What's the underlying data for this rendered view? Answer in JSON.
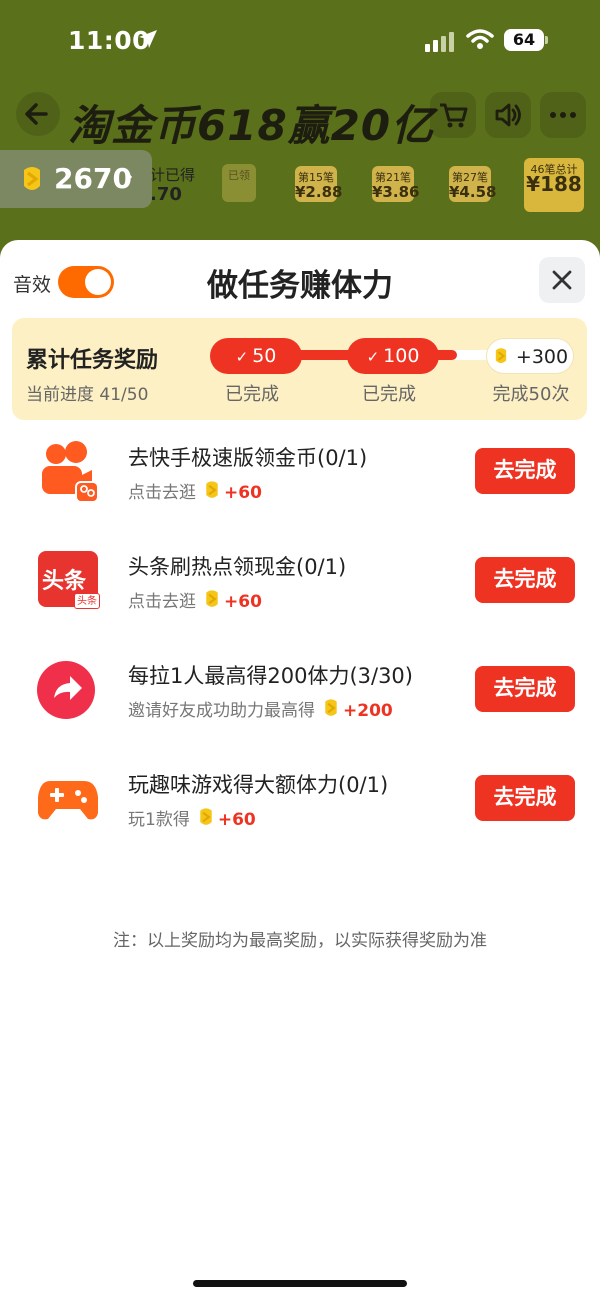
{
  "status_bar": {
    "time": "11:00",
    "battery": "64"
  },
  "background": {
    "title": "淘金币618赢20亿",
    "balance": "2670",
    "strip": {
      "accum_label": "计已得",
      "accum_value": ".70",
      "pills": [
        {
          "top": "已领",
          "value": ""
        },
        {
          "top": "第15笔",
          "value": "¥2.88"
        },
        {
          "top": "第21笔",
          "value": "¥3.86"
        },
        {
          "top": "第27笔",
          "value": "¥4.58"
        },
        {
          "top": "46笔总计",
          "value": "¥188"
        }
      ]
    }
  },
  "sheet": {
    "sound_label": "音效",
    "sound_on": true,
    "title": "做任务赚体力",
    "cumulative": {
      "title": "累计任务奖励",
      "progress": "当前进度 41/50",
      "progress_fraction": 0.82,
      "milestones": [
        {
          "value": "50",
          "label": "已完成",
          "done": true
        },
        {
          "value": "100",
          "label": "已完成",
          "done": true
        },
        {
          "value": "+300",
          "label": "完成50次",
          "done": false
        }
      ]
    },
    "tasks": [
      {
        "name": "去快手极速版领金币(0/1)",
        "sub": "点击去逛",
        "reward": "+60",
        "button": "去完成",
        "icon": "kuaishou-icon"
      },
      {
        "name": "头条刷热点领现金(0/1)",
        "sub": "点击去逛",
        "reward": "+60",
        "button": "去完成",
        "icon": "toutiao-icon",
        "icon_text": "头条",
        "icon_badge": "头条"
      },
      {
        "name": "每拉1人最高得200体力(3/30)",
        "sub": "邀请好友成功助力最高得",
        "reward": "+200",
        "button": "去完成",
        "icon": "share-icon"
      },
      {
        "name": "玩趣味游戏得大额体力(0/1)",
        "sub": "玩1款得",
        "reward": "+60",
        "button": "去完成",
        "icon": "gamepad-icon"
      }
    ],
    "note": "注：以上奖励均为最高奖励，以实际获得奖励为准"
  },
  "colors": {
    "accent": "#ef3322",
    "toggle": "#ff6a00",
    "panel": "#fdf0c4",
    "coin": "#f5c518"
  }
}
